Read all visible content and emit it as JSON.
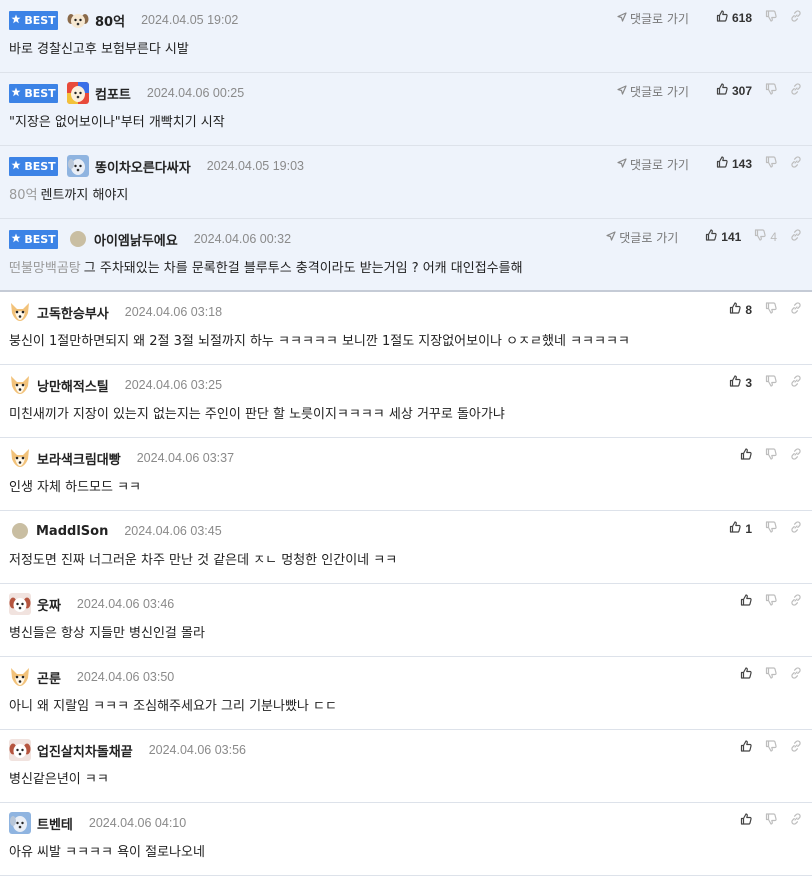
{
  "best_label": "BEST",
  "goto_label": "댓글로 가기",
  "comments": [
    {
      "best": true,
      "avatar": "puppy",
      "nick": "80억",
      "date": "2024.04.05 19:02",
      "prefix": "",
      "text": "바로 경찰신고후 보험부른다 시발",
      "likes": "618",
      "dislikes": ""
    },
    {
      "best": true,
      "avatar": "dog-color",
      "nick": "컴포트",
      "date": "2024.04.06 00:25",
      "prefix": "",
      "text": "\"지장은 없어보이나\"부터 개빡치기 시작",
      "likes": "307",
      "dislikes": ""
    },
    {
      "best": true,
      "avatar": "dog-blue",
      "nick": "똥이차오른다싸자",
      "date": "2024.04.05 19:03",
      "prefix": "80억",
      "text": "렌트까지 해야지",
      "likes": "143",
      "dislikes": ""
    },
    {
      "best": true,
      "avatar": "dot",
      "nick": "아이엠낡두에요",
      "date": "2024.04.06 00:32",
      "prefix": "떤불망백곰탕",
      "text": "그 주차돼있는 차를 문록한걸 블루투스 충격이라도 받는거임 ? 어캐 대인접수를해",
      "likes": "141",
      "dislikes": "4"
    },
    {
      "best": false,
      "avatar": "fox",
      "nick": "고독한승부사",
      "date": "2024.04.06 03:18",
      "prefix": "",
      "text": "붕신이 1절만하면되지 왜 2절 3절 뇌절까지 하누 ㅋㅋㅋㅋㅋ 보니깐 1절도 지장없어보이나 ㅇㅈㄹ했네 ㅋㅋㅋㅋㅋ",
      "likes": "8",
      "dislikes": ""
    },
    {
      "best": false,
      "avatar": "fox",
      "nick": "낭만해적스틸",
      "date": "2024.04.06 03:25",
      "prefix": "",
      "text": "미친새끼가 지장이 있는지 없는지는 주인이 판단 할 노릇이지ㅋㅋㅋㅋ 세상 거꾸로 돌아가냐",
      "likes": "3",
      "dislikes": ""
    },
    {
      "best": false,
      "avatar": "fox",
      "nick": "보라색크림대빵",
      "date": "2024.04.06 03:37",
      "prefix": "",
      "text": "인생 자체 하드모드 ㅋㅋ",
      "likes": "",
      "dislikes": ""
    },
    {
      "best": false,
      "avatar": "dot",
      "nick": "MaddlSon",
      "date": "2024.04.06 03:45",
      "prefix": "",
      "text": "저정도면 진짜 너그러운 차주 만난 것 같은데 ㅈㄴ 멍청한 인간이네 ㅋㅋ",
      "likes": "1",
      "dislikes": ""
    },
    {
      "best": false,
      "avatar": "puppy-red",
      "nick": "웃짜",
      "date": "2024.04.06 03:46",
      "prefix": "",
      "text": "병신들은 항상 지들만 병신인걸 몰라",
      "likes": "",
      "dislikes": ""
    },
    {
      "best": false,
      "avatar": "fox",
      "nick": "곤룬",
      "date": "2024.04.06 03:50",
      "prefix": "",
      "text": "아니 왜 지랄임 ㅋㅋㅋ 조심해주세요가 그리 기분나빴나 ㄷㄷ",
      "likes": "",
      "dislikes": ""
    },
    {
      "best": false,
      "avatar": "puppy-red",
      "nick": "업진살치차돌채끝",
      "date": "2024.04.06 03:56",
      "prefix": "",
      "text": "병신같은년이 ㅋㅋ",
      "likes": "",
      "dislikes": ""
    },
    {
      "best": false,
      "avatar": "dog-blue",
      "nick": "트벤테",
      "date": "2024.04.06 04:10",
      "prefix": "",
      "text": "아유 씨발 ㅋㅋㅋㅋ 욕이 절로나오네",
      "likes": "",
      "dislikes": ""
    }
  ],
  "colors": {
    "best_bg": "#eef3fb",
    "badge": "#3c83e6",
    "divider": "#dde2ea"
  }
}
